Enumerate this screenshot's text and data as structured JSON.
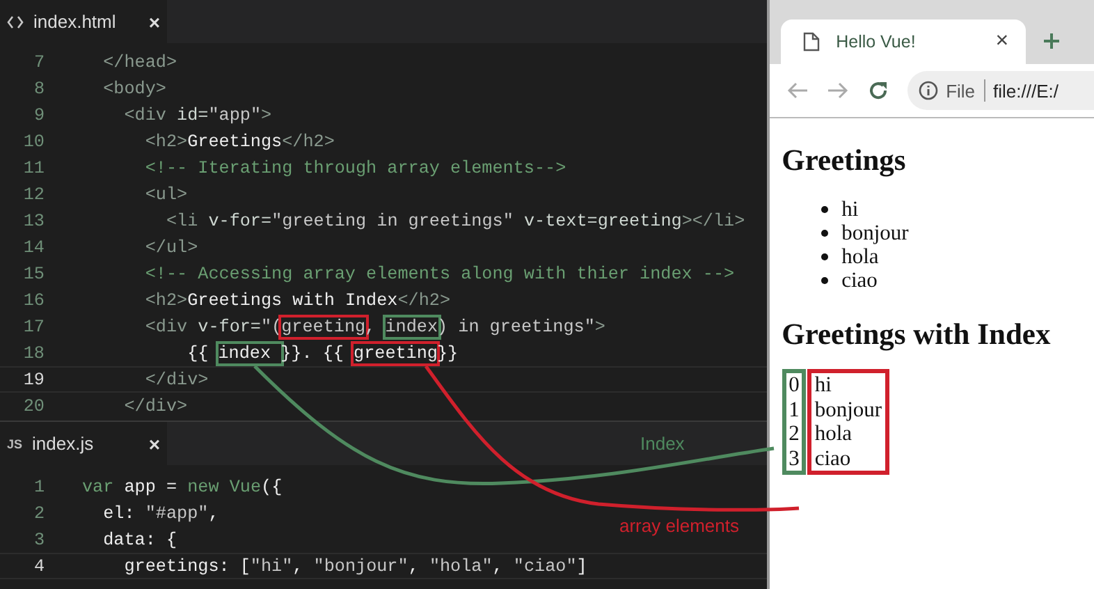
{
  "editor_top": {
    "tab": {
      "label": "index.html",
      "close": "×"
    },
    "lines": [
      {
        "num": "7",
        "current": false,
        "tokens": [
          {
            "t": "  </head>",
            "kind": "tag"
          }
        ]
      },
      {
        "num": "8",
        "current": false,
        "tokens": [
          {
            "t": "  <body>",
            "kind": "tag"
          }
        ]
      },
      {
        "num": "9",
        "current": false,
        "tokens": [
          {
            "t": "    <div ",
            "kind": "tag"
          },
          {
            "t": "id=",
            "kind": "attr"
          },
          {
            "t": "\"app\"",
            "kind": "str"
          },
          {
            "t": ">",
            "kind": "tag"
          }
        ]
      },
      {
        "num": "10",
        "current": false,
        "tokens": [
          {
            "t": "      <h2>",
            "kind": "tag"
          },
          {
            "t": "Greetings",
            "kind": "txt"
          },
          {
            "t": "</h2>",
            "kind": "tag"
          }
        ]
      },
      {
        "num": "11",
        "current": false,
        "tokens": [
          {
            "t": "      <!-- Iterating through array elements-->",
            "kind": "cmt"
          }
        ]
      },
      {
        "num": "12",
        "current": false,
        "tokens": [
          {
            "t": "      <ul>",
            "kind": "tag"
          }
        ]
      },
      {
        "num": "13",
        "current": false,
        "tokens": [
          {
            "t": "        <li ",
            "kind": "tag"
          },
          {
            "t": "v-for=",
            "kind": "attr"
          },
          {
            "t": "\"greeting in greetings\"",
            "kind": "str"
          },
          {
            "t": " v-text=greeting",
            "kind": "attr"
          },
          {
            "t": "></li>",
            "kind": "tag"
          }
        ]
      },
      {
        "num": "14",
        "current": false,
        "tokens": [
          {
            "t": "      </ul>",
            "kind": "tag"
          }
        ]
      },
      {
        "num": "15",
        "current": false,
        "tokens": [
          {
            "t": "      <!-- Accessing array elements along with thier index -->",
            "kind": "cmt"
          }
        ]
      },
      {
        "num": "16",
        "current": false,
        "tokens": [
          {
            "t": "      <h2>",
            "kind": "tag"
          },
          {
            "t": "Greetings with Index",
            "kind": "txt"
          },
          {
            "t": "</h2>",
            "kind": "tag"
          }
        ]
      },
      {
        "num": "17",
        "current": false,
        "tokens": [
          {
            "t": "      <div ",
            "kind": "tag"
          },
          {
            "t": "v-for=",
            "kind": "attr"
          },
          {
            "t": "\"(",
            "kind": "str"
          },
          {
            "t": "greeting",
            "kind": "str",
            "color": "#d0202c"
          },
          {
            "t": ", ",
            "kind": "str"
          },
          {
            "t": "index",
            "kind": "str",
            "color": "#4f8a5f"
          },
          {
            "t": ") in greetings\"",
            "kind": "str"
          },
          {
            "t": ">",
            "kind": "tag"
          }
        ]
      },
      {
        "num": "18",
        "current": false,
        "tokens": [
          {
            "t": "          {{ ",
            "kind": "txt"
          },
          {
            "t": "index ",
            "kind": "txt",
            "color": "#4f8a5f"
          },
          {
            "t": "}}. {{ ",
            "kind": "txt"
          },
          {
            "t": "greeting",
            "kind": "txt",
            "color": "#d0202c"
          },
          {
            "t": "}}",
            "kind": "txt"
          }
        ]
      },
      {
        "num": "19",
        "current": true,
        "tokens": [
          {
            "t": "      </div>",
            "kind": "tag"
          }
        ]
      },
      {
        "num": "20",
        "current": false,
        "tokens": [
          {
            "t": "    </div>",
            "kind": "tag"
          }
        ]
      }
    ]
  },
  "editor_bottom": {
    "tab": {
      "badge": "JS",
      "label": "index.js",
      "close": "×"
    },
    "lines": [
      {
        "num": "1",
        "current": false,
        "tokens": [
          {
            "t": "var",
            "kind": "kw"
          },
          {
            "t": " app = ",
            "kind": "txt"
          },
          {
            "t": "new",
            "kind": "kw"
          },
          {
            "t": " Vue",
            "kind": "kw"
          },
          {
            "t": "({",
            "kind": "txt"
          }
        ]
      },
      {
        "num": "2",
        "current": false,
        "tokens": [
          {
            "t": "  el: ",
            "kind": "txt"
          },
          {
            "t": "\"#app\"",
            "kind": "str"
          },
          {
            "t": ",",
            "kind": "txt"
          }
        ]
      },
      {
        "num": "3",
        "current": false,
        "tokens": [
          {
            "t": "  data: {",
            "kind": "txt"
          }
        ]
      },
      {
        "num": "4",
        "current": true,
        "tokens": [
          {
            "t": "    greetings: [",
            "kind": "txt"
          },
          {
            "t": "\"hi\"",
            "kind": "str"
          },
          {
            "t": ", ",
            "kind": "txt"
          },
          {
            "t": "\"bonjour\"",
            "kind": "str"
          },
          {
            "t": ", ",
            "kind": "txt"
          },
          {
            "t": "\"hola\"",
            "kind": "str"
          },
          {
            "t": ", ",
            "kind": "txt"
          },
          {
            "t": "\"ciao\"",
            "kind": "str"
          },
          {
            "t": "]",
            "kind": "txt"
          }
        ]
      }
    ]
  },
  "annotations": [
    {
      "label": "Index",
      "color": "#4f8a5f"
    },
    {
      "label": "array elements",
      "color": "#d0202c"
    }
  ],
  "browser": {
    "tab": {
      "title": "Hello Vue!",
      "close": "×"
    },
    "address": {
      "scheme": "File",
      "url": "file:///E:/"
    },
    "heading_1": "Greetings",
    "list": [
      "hi",
      "bonjour",
      "hola",
      "ciao"
    ],
    "heading_2": "Greetings with Index",
    "indexed_rows": [
      {
        "index": "0",
        "value": "hi"
      },
      {
        "index": "1",
        "value": "bonjour"
      },
      {
        "index": "2",
        "value": "hola"
      },
      {
        "index": "3",
        "value": "ciao"
      }
    ]
  }
}
